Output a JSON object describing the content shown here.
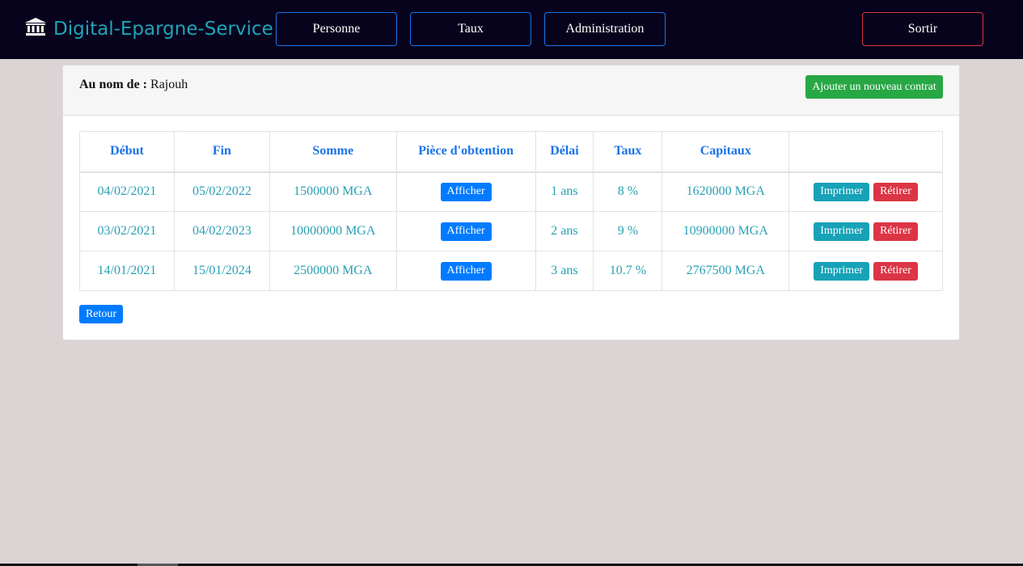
{
  "navbar": {
    "brand": "Digital-Epargne-Service",
    "brand_icon": "bank-icon",
    "links": [
      "Personne",
      "Taux",
      "Administration"
    ],
    "logout": "Sortir",
    "colors": {
      "background": "#07031d",
      "brand": "#20a4b8",
      "link_border": "#1a73e8",
      "logout_border": "#dc3545"
    }
  },
  "header": {
    "owner_label": "Au nom de :",
    "owner_name": "Rajouh",
    "add_button": "Ajouter un nouveau contrat"
  },
  "table": {
    "columns": [
      "Début",
      "Fin",
      "Somme",
      "Pièce d'obtention",
      "Délai",
      "Taux",
      "Capitaux",
      ""
    ],
    "rows": [
      {
        "debut": "04/02/2021",
        "fin": "05/02/2022",
        "somme": "1500000 MGA",
        "piece": "Afficher",
        "delai": "1 ans",
        "taux": "8 %",
        "capitaux": "1620000 MGA",
        "print": "Imprimer",
        "remove": "Rétirer"
      },
      {
        "debut": "03/02/2021",
        "fin": "04/02/2023",
        "somme": "10000000 MGA",
        "piece": "Afficher",
        "delai": "2 ans",
        "taux": "9 %",
        "capitaux": "10900000 MGA",
        "print": "Imprimer",
        "remove": "Rétirer"
      },
      {
        "debut": "14/01/2021",
        "fin": "15/01/2024",
        "somme": "2500000 MGA",
        "piece": "Afficher",
        "delai": "3 ans",
        "taux": "10.7 %",
        "capitaux": "2767500 MGA",
        "print": "Imprimer",
        "remove": "Rétirer"
      }
    ]
  },
  "footer": {
    "back_button": "Retour"
  }
}
